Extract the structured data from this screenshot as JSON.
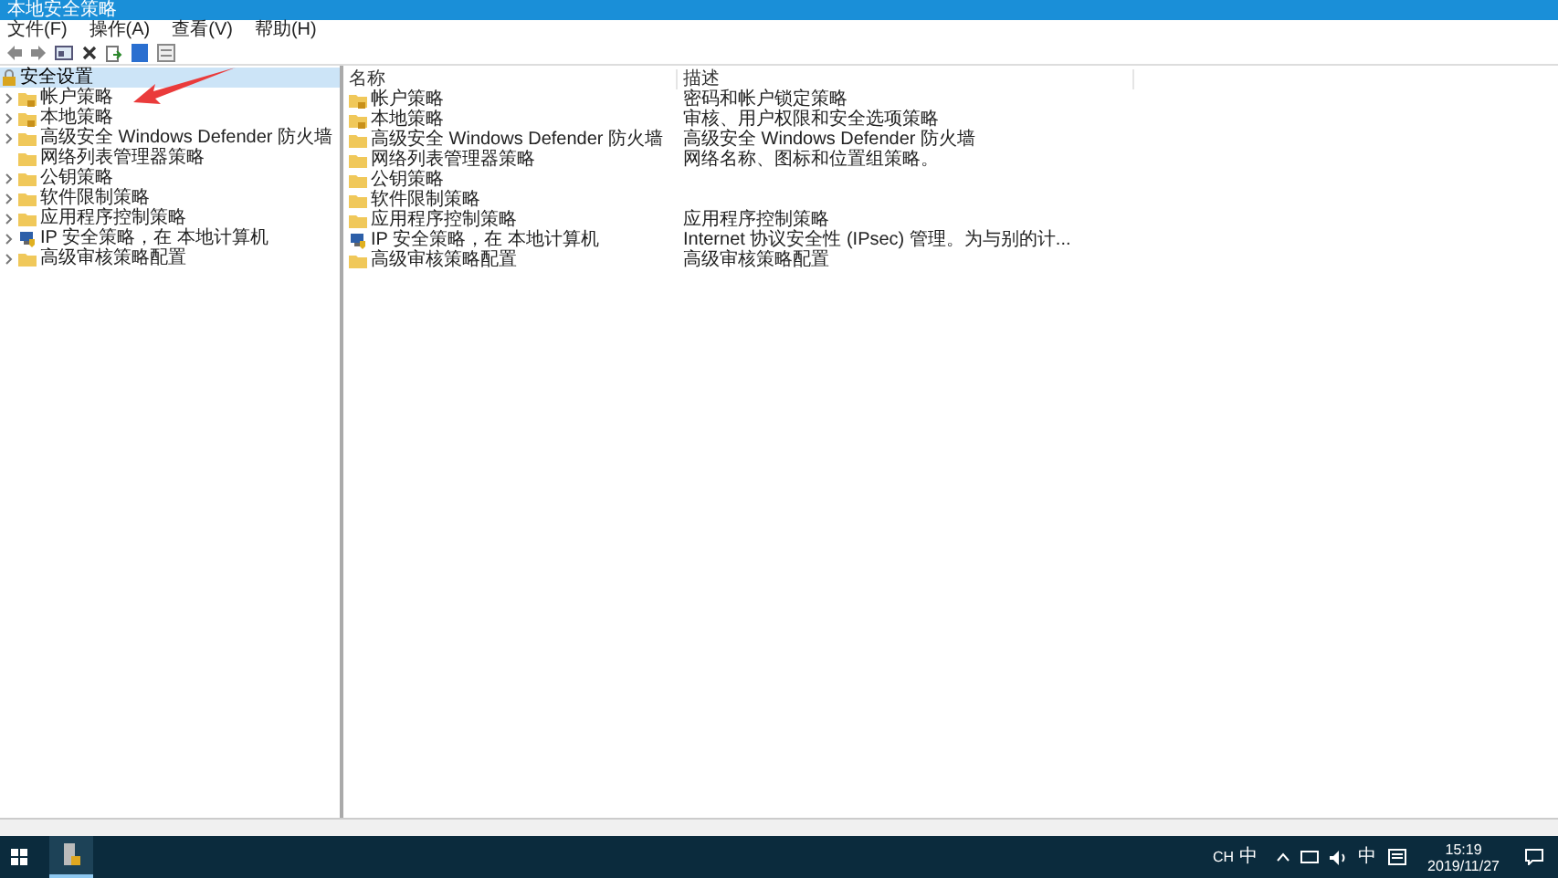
{
  "window": {
    "title": "本地安全策略"
  },
  "menu": [
    "文件(F)",
    "操作(A)",
    "查看(V)",
    "帮助(H)"
  ],
  "tree": {
    "label": "安全设置",
    "expanded": true,
    "selected": true,
    "children": [
      {
        "label": "帐户策略",
        "kind": "lockfolder",
        "expandable": true
      },
      {
        "label": "本地策略",
        "kind": "lockfolder",
        "expandable": true
      },
      {
        "label": "高级安全 Windows Defender 防火墙",
        "kind": "folder",
        "expandable": true
      },
      {
        "label": "网络列表管理器策略",
        "kind": "folder",
        "expandable": false
      },
      {
        "label": "公钥策略",
        "kind": "folder",
        "expandable": true
      },
      {
        "label": "软件限制策略",
        "kind": "folder",
        "expandable": true
      },
      {
        "label": "应用程序控制策略",
        "kind": "folder",
        "expandable": true
      },
      {
        "label": "IP 安全策略，在 本地计算机",
        "kind": "ipsec",
        "expandable": true
      },
      {
        "label": "高级审核策略配置",
        "kind": "folder",
        "expandable": true
      }
    ]
  },
  "list": {
    "columns": [
      "名称",
      "描述"
    ],
    "rows": [
      {
        "name": "帐户策略",
        "kind": "lockfolder",
        "description": "密码和帐户锁定策略"
      },
      {
        "name": "本地策略",
        "kind": "lockfolder",
        "description": "审核、用户权限和安全选项策略"
      },
      {
        "name": "高级安全 Windows Defender 防火墙",
        "kind": "folder",
        "description": "高级安全 Windows Defender 防火墙"
      },
      {
        "name": "网络列表管理器策略",
        "kind": "folder",
        "description": "网络名称、图标和位置组策略。"
      },
      {
        "name": "公钥策略",
        "kind": "folder"
      },
      {
        "name": "软件限制策略",
        "kind": "folder"
      },
      {
        "name": "应用程序控制策略",
        "kind": "folder",
        "description": "应用程序控制策略"
      },
      {
        "name": "IP 安全策略，在 本地计算机",
        "kind": "ipsec",
        "description": "Internet 协议安全性 (IPsec) 管理。为与别的计..."
      },
      {
        "name": "高级审核策略配置",
        "kind": "folder",
        "description": "高级审核策略配置"
      }
    ]
  },
  "tray": {
    "ime": "CH",
    "ime_mode": "中",
    "input": "中",
    "time": "15:19",
    "date": "2019/11/27"
  }
}
